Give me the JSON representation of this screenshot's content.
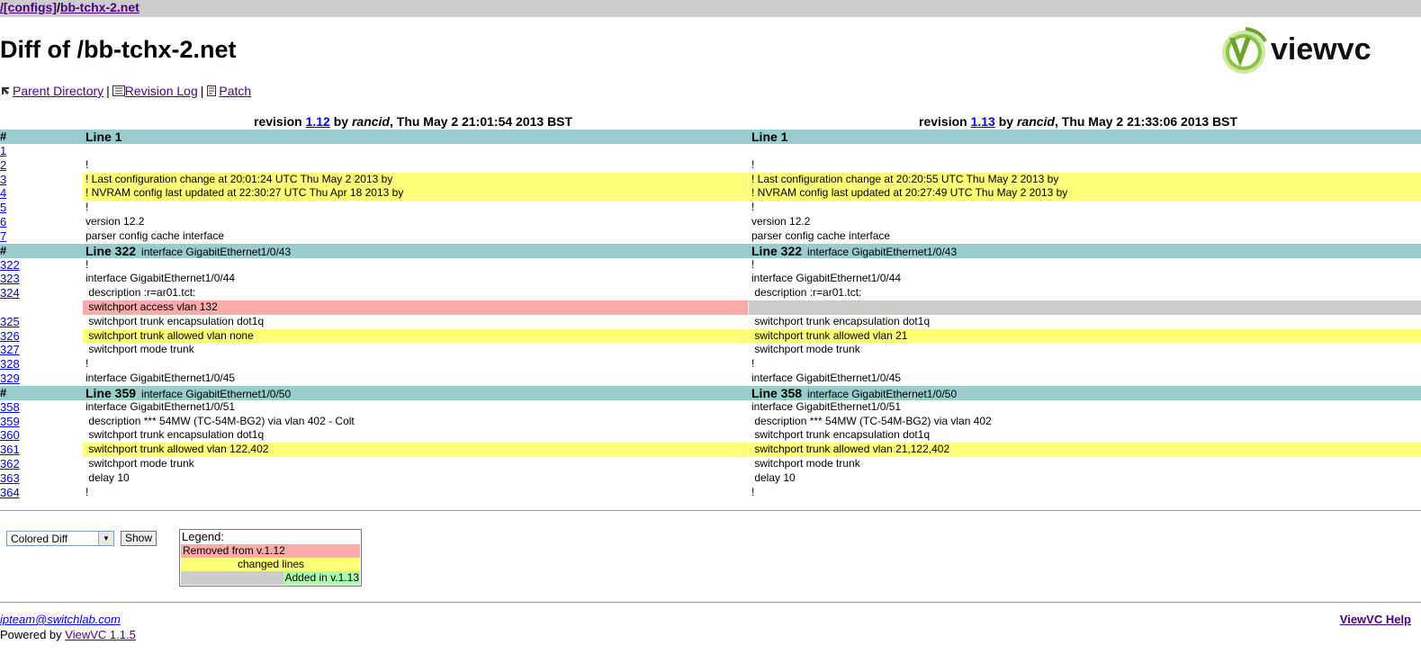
{
  "breadcrumb": {
    "root": "/",
    "configs": "[configs]",
    "slash": "/",
    "file": "bb-tchx-2.net"
  },
  "page_title": "Diff of /bb-tchx-2.net",
  "logo": {
    "text": "viewvc"
  },
  "nav": {
    "parent": "Parent Directory",
    "sep": "|",
    "revlog": "Revision Log",
    "patch": "Patch"
  },
  "revs": {
    "left": {
      "pre": "revision ",
      "num": "1.12",
      "by": " by ",
      "author": "rancid",
      "date": ", Thu May 2 21:01:54 2013 BST"
    },
    "right": {
      "pre": "revision ",
      "num": "1.13",
      "by": " by ",
      "author": "rancid",
      "date": ", Thu May 2 21:33:06 2013 BST"
    }
  },
  "header_mark": "#",
  "sections": [
    {
      "left_line": "Line 1",
      "left_ctx": "",
      "right_line": "Line 1",
      "right_ctx": "",
      "rows": [
        {
          "num": "1",
          "left": "",
          "right": "",
          "type": "same"
        },
        {
          "num": "2",
          "left": "!",
          "right": "!",
          "type": "same"
        },
        {
          "num": "3",
          "left": "! Last configuration change at 20:01:24 UTC Thu May 2 2013 by",
          "right": "! Last configuration change at 20:20:55 UTC Thu May 2 2013 by",
          "type": "chg"
        },
        {
          "num": "4",
          "left": "! NVRAM config last updated at 22:30:27 UTC Thu Apr 18 2013 by",
          "right": "! NVRAM config last updated at 20:27:49 UTC Thu May 2 2013 by",
          "type": "chg"
        },
        {
          "num": "5",
          "left": "!",
          "right": "!",
          "type": "same"
        },
        {
          "num": "6",
          "left": "version 12.2",
          "right": "version 12.2",
          "type": "same"
        },
        {
          "num": "7",
          "left": "parser config cache interface",
          "right": "parser config cache interface",
          "type": "same"
        }
      ]
    },
    {
      "left_line": "Line 322",
      "left_ctx": "interface GigabitEthernet1/0/43",
      "right_line": "Line 322",
      "right_ctx": "interface GigabitEthernet1/0/43",
      "rows": [
        {
          "num": "322",
          "left": "!",
          "right": "!",
          "type": "same"
        },
        {
          "num": "323",
          "left": "interface GigabitEthernet1/0/44",
          "right": "interface GigabitEthernet1/0/44",
          "type": "same"
        },
        {
          "num": "324",
          "left": " description :r=ar01.tct:",
          "right": " description :r=ar01.tct:",
          "type": "same"
        },
        {
          "num": "",
          "left": " switchport access vlan 132",
          "right": "",
          "type": "rem"
        },
        {
          "num": "325",
          "left": " switchport trunk encapsulation dot1q",
          "right": " switchport trunk encapsulation dot1q",
          "type": "same"
        },
        {
          "num": "326",
          "left": " switchport trunk allowed vlan none",
          "right": " switchport trunk allowed vlan 21",
          "type": "chg"
        },
        {
          "num": "327",
          "left": " switchport mode trunk",
          "right": " switchport mode trunk",
          "type": "same"
        },
        {
          "num": "328",
          "left": "!",
          "right": "!",
          "type": "same"
        },
        {
          "num": "329",
          "left": "interface GigabitEthernet1/0/45",
          "right": "interface GigabitEthernet1/0/45",
          "type": "same"
        }
      ]
    },
    {
      "left_line": "Line 359",
      "left_ctx": "interface GigabitEthernet1/0/50",
      "right_line": "Line 358",
      "right_ctx": "interface GigabitEthernet1/0/50",
      "rows": [
        {
          "num": "358",
          "left": "interface GigabitEthernet1/0/51",
          "right": "interface GigabitEthernet1/0/51",
          "type": "same"
        },
        {
          "num": "359",
          "left": " description *** 54MW (TC-54M-BG2) via vlan 402 - Colt",
          "right": " description *** 54MW (TC-54M-BG2) via vlan 402",
          "type": "same"
        },
        {
          "num": "360",
          "left": " switchport trunk encapsulation dot1q",
          "right": " switchport trunk encapsulation dot1q",
          "type": "same"
        },
        {
          "num": "361",
          "left": " switchport trunk allowed vlan 122,402",
          "right": " switchport trunk allowed vlan 21,122,402",
          "type": "chg"
        },
        {
          "num": "362",
          "left": " switchport mode trunk",
          "right": " switchport mode trunk",
          "type": "same"
        },
        {
          "num": "363",
          "left": " delay 10",
          "right": " delay 10",
          "type": "same"
        },
        {
          "num": "364",
          "left": "!",
          "right": "!",
          "type": "same"
        }
      ]
    }
  ],
  "form": {
    "select_value": "Colored Diff",
    "show_label": "Show"
  },
  "legend": {
    "title": "Legend:",
    "removed": "Removed from v.1.12",
    "changed": "changed lines",
    "added": "Added in v.1.13"
  },
  "footer": {
    "email": "ipteam@switchlab.com",
    "powered": "Powered by ",
    "viewvc": "ViewVC 1.1.5",
    "help": "ViewVC Help"
  },
  "colors": {
    "header_bg": "#99cccc",
    "changed": "#ffff77",
    "removed": "#ffaaaa",
    "added": "#aaffaa",
    "empty": "#cccccc"
  }
}
